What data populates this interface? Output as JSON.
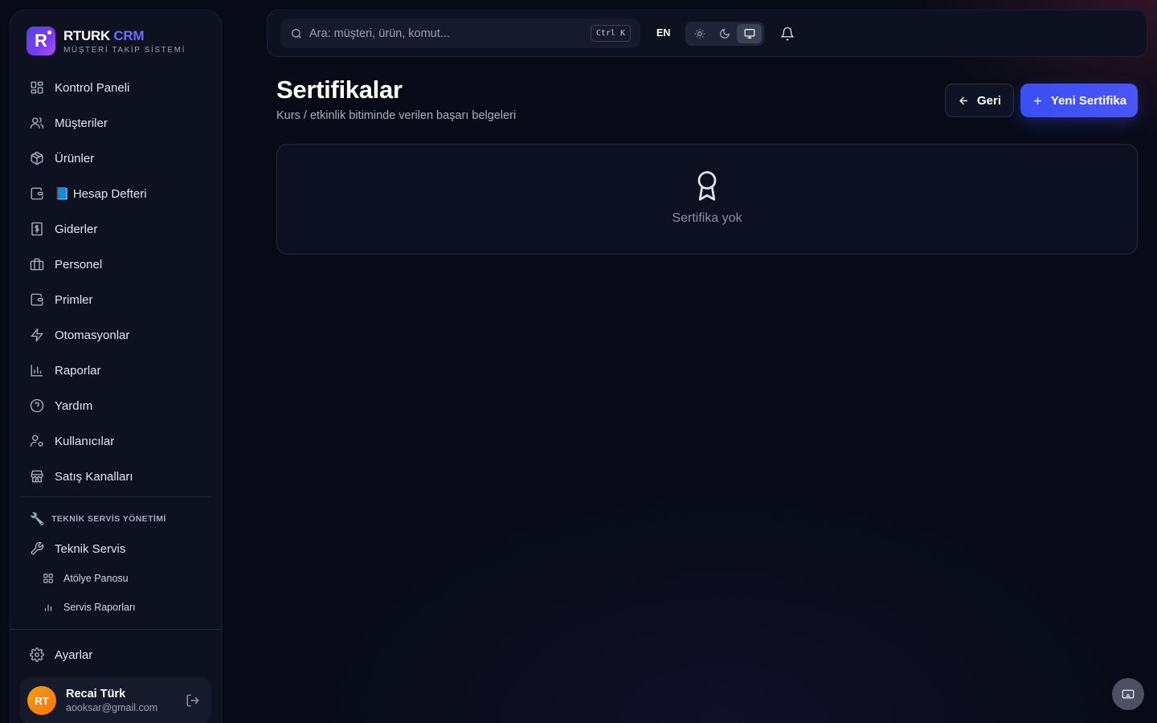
{
  "brand": {
    "logo_letter": "R",
    "name_main": "RTURK",
    "name_accent": " CRM",
    "subtitle": "MÜŞTERİ TAKİP SİSTEMİ"
  },
  "sidebar": {
    "items": [
      {
        "label": "Kontrol Paneli",
        "icon": "dashboard-icon"
      },
      {
        "label": "Müşteriler",
        "icon": "users-icon"
      },
      {
        "label": "Ürünler",
        "icon": "package-icon"
      },
      {
        "label": "📘 Hesap Defteri",
        "icon": "wallet-icon"
      },
      {
        "label": "Giderler",
        "icon": "receipt-icon"
      },
      {
        "label": "Personel",
        "icon": "briefcase-icon"
      },
      {
        "label": "Primler",
        "icon": "wallet-icon"
      },
      {
        "label": "Otomasyonlar",
        "icon": "zap-icon"
      },
      {
        "label": "Raporlar",
        "icon": "bar-chart-icon"
      },
      {
        "label": "Yardım",
        "icon": "help-circle-icon"
      },
      {
        "label": "Kullanıcılar",
        "icon": "user-cog-icon"
      },
      {
        "label": "Satış Kanalları",
        "icon": "store-icon"
      }
    ],
    "section": {
      "emoji": "🔧",
      "title": "TEKNİK SERVİS YÖNETİMİ",
      "main_item": "Teknik Servis",
      "sub_items": [
        "Atölye Panosu",
        "Servis Raporları"
      ]
    },
    "settings_label": "Ayarlar",
    "user": {
      "initials": "RT",
      "name": "Recai Türk",
      "email": "aooksar@gmail.com"
    }
  },
  "topbar": {
    "search_placeholder": "Ara: müşteri, ürün, komut...",
    "shortcut": "Ctrl K",
    "language": "EN",
    "theme_options": [
      "light",
      "dark",
      "system"
    ],
    "theme_selected": "system"
  },
  "main": {
    "title": "Sertifikalar",
    "subtitle": "Kurs / etkinlik bitiminde verilen başarı belgeleri",
    "back_label": "Geri",
    "new_label": "Yeni Sertifika",
    "empty_text": "Sertifika yok"
  },
  "colors": {
    "background": "#080b17",
    "panel": "#0d1120",
    "accent": "#4a55f5",
    "brand_accent": "#6d6cff",
    "avatar": "#f97316"
  }
}
